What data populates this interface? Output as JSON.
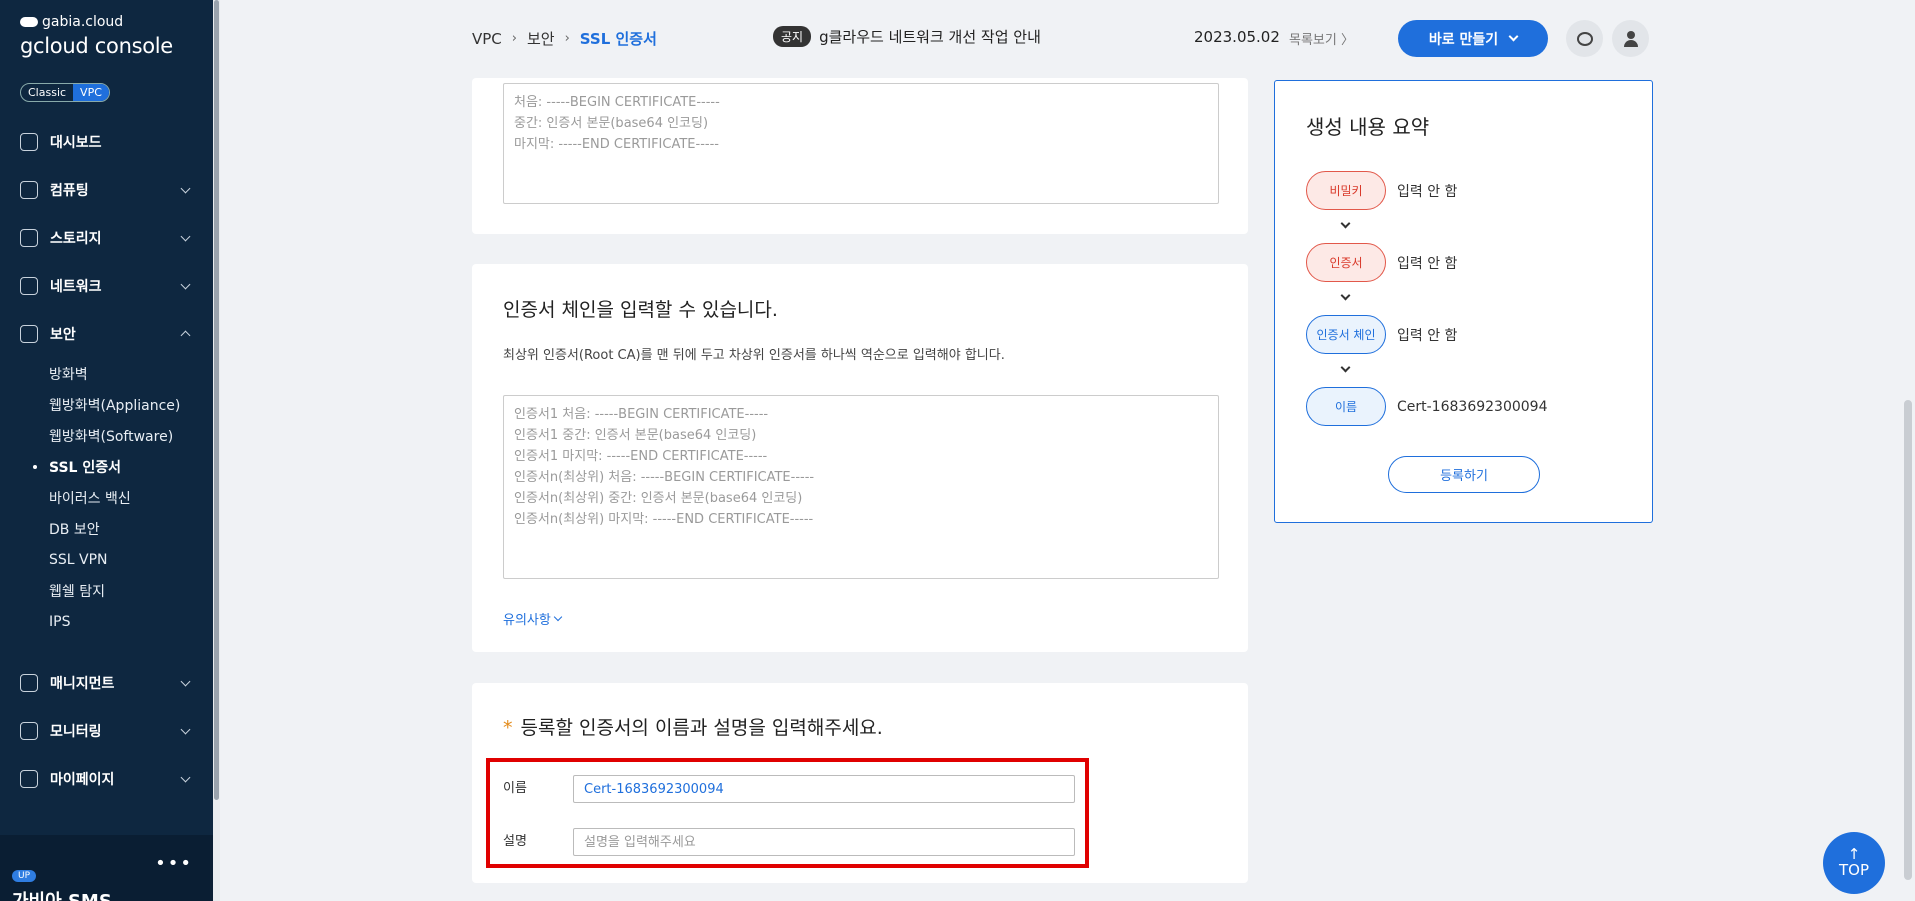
{
  "brand": {
    "small": "gabia.cloud",
    "big": "gcloud console"
  },
  "mode": {
    "classic": "Classic",
    "vpc": "VPC"
  },
  "nav": {
    "dashboard": "대시보드",
    "computing": "컴퓨팅",
    "storage": "스토리지",
    "network": "네트워크",
    "security": "보안",
    "security_sub": [
      "방화벽",
      "웹방화벽(Appliance)",
      "웹방화벽(Software)",
      "SSL 인증서",
      "바이러스 백신",
      "DB 보안",
      "SSL VPN",
      "웹쉘 탐지",
      "IPS"
    ],
    "management": "매니지먼트",
    "monitoring": "모니터링",
    "mypage": "마이페이지"
  },
  "sidebar_bottom": {
    "dots": "•••",
    "badge": "UP",
    "sms": "가비아 SMS"
  },
  "breadcrumb": [
    "VPC",
    "보안",
    "SSL 인증서"
  ],
  "breadcrumb_sep": "›",
  "notice": {
    "tag": "공지",
    "text": "g클라우드 네트워크 개선 작업 안내",
    "date": "2023.05.02",
    "list_link": "목록보기 〉"
  },
  "make_button": "바로 만들기",
  "cert_card": {
    "placeholder": "처음: -----BEGIN CERTIFICATE-----\n중간: 인증서 본문(base64 인코딩)\n마지막: -----END CERTIFICATE-----"
  },
  "chain_card": {
    "title": "인증서 체인을 입력할 수 있습니다.",
    "desc": "최상위 인증서(Root CA)를 맨 뒤에 두고 차상위 인증서를 하나씩 역순으로 입력해야 합니다.",
    "placeholder": "인증서1 처음: -----BEGIN CERTIFICATE-----\n인증서1 중간: 인증서 본문(base64 인코딩)\n인증서1 마지막: -----END CERTIFICATE-----\n인증서n(최상위) 처음: -----BEGIN CERTIFICATE-----\n인증서n(최상위) 중간: 인증서 본문(base64 인코딩)\n인증서n(최상위) 마지막: -----END CERTIFICATE-----",
    "caution": "유의사항"
  },
  "name_card": {
    "required_mark": "*",
    "title": "등록할 인증서의 이름과 설명을 입력해주세요.",
    "name_label": "이름",
    "name_value": "Cert-1683692300094",
    "desc_label": "설명",
    "desc_placeholder": "설명을 입력해주세요"
  },
  "summary": {
    "title": "생성 내용 요약",
    "steps": [
      {
        "label": "비밀키",
        "value": "입력 안 함",
        "state": "error"
      },
      {
        "label": "인증서",
        "value": "입력 안 함",
        "state": "error"
      },
      {
        "label": "인증서 체인",
        "value": "입력 안 함",
        "state": "ok"
      },
      {
        "label": "이름",
        "value": "Cert-1683692300094",
        "state": "ok"
      }
    ],
    "register": "등록하기"
  },
  "top_button": {
    "arrow": "↑",
    "label": "TOP"
  },
  "colors": {
    "accent": "#1f6fdc",
    "sidebar": "#0e2740",
    "error": "#d9392a",
    "highlight": "#e00000"
  }
}
